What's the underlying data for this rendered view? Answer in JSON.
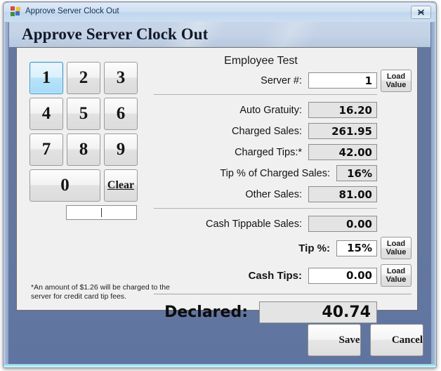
{
  "window": {
    "title": "Approve Server Clock Out",
    "app_icon": "windows-logo-icon",
    "close_label": "Close",
    "header_title": "Approve Server Clock Out",
    "accent_color": "#64789f",
    "header_band_color": "#c3d2e6",
    "panel_color": "#f0f0f0"
  },
  "keypad": {
    "keys": [
      "1",
      "2",
      "3",
      "4",
      "5",
      "6",
      "7",
      "8",
      "9",
      "0"
    ],
    "clear_label": "Clear",
    "active_key": "1",
    "active_key_color": "#b9e3f9",
    "entry_value": "",
    "entry_placeholder": ""
  },
  "footnote": {
    "text": "*An amount of $1.26 will be charged to the server for credit card tip fees."
  },
  "form": {
    "employee_name": "Employee Test",
    "server": {
      "label": "Server #:",
      "value": "1",
      "load_line1": "Load",
      "load_line2": "Value"
    },
    "fields": [
      {
        "label": "Auto Gratuity:",
        "value": "16.20",
        "readonly": true,
        "width": "std",
        "bold_label": false,
        "load": false
      },
      {
        "label": "Charged Sales:",
        "value": "261.95",
        "readonly": true,
        "width": "std",
        "bold_label": false,
        "load": false
      },
      {
        "label": "Charged Tips:*",
        "value": "42.00",
        "readonly": true,
        "width": "std",
        "bold_label": false,
        "load": false
      },
      {
        "label": "Tip % of Charged Sales:",
        "value": "16%",
        "readonly": true,
        "width": "narrow",
        "bold_label": false,
        "load": false
      },
      {
        "label": "Other Sales:",
        "value": "81.00",
        "readonly": true,
        "width": "std",
        "bold_label": false,
        "load": false
      }
    ],
    "cash_fields": [
      {
        "label": "Cash Tippable Sales:",
        "value": "0.00",
        "readonly": true,
        "width": "std",
        "bold_label": false,
        "load": false
      },
      {
        "label": "Tip %:",
        "value": "15%",
        "readonly": false,
        "width": "narrow",
        "bold_label": true,
        "load": true
      },
      {
        "label": "Cash Tips:",
        "value": "0.00",
        "readonly": false,
        "width": "std",
        "bold_label": true,
        "load": true
      }
    ],
    "load_line1": "Load",
    "load_line2": "Value",
    "declared": {
      "label": "Declared:",
      "value": "40.74"
    }
  },
  "footer": {
    "save_label": "Save",
    "cancel_label": "Cancel"
  }
}
